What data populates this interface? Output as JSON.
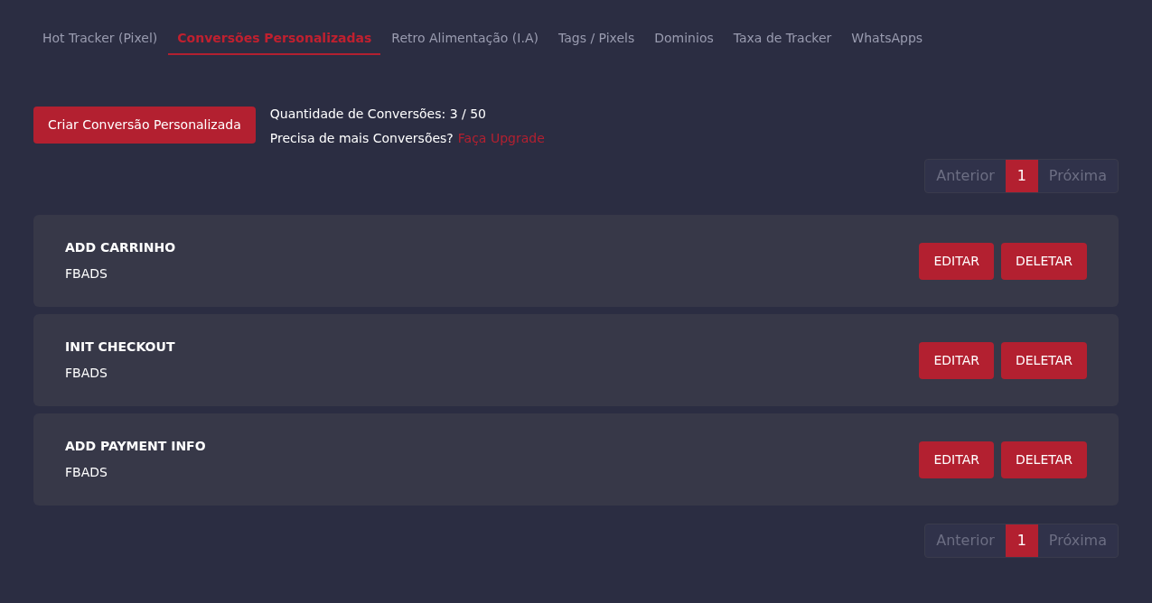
{
  "tabs": [
    {
      "label": "Hot Tracker (Pixel)",
      "selected": false
    },
    {
      "label": "Conversões Personalizadas",
      "selected": true
    },
    {
      "label": "Retro Alimentação (I.A)",
      "selected": false
    },
    {
      "label": "Tags / Pixels",
      "selected": false
    },
    {
      "label": "Dominios",
      "selected": false
    },
    {
      "label": "Taxa de Tracker",
      "selected": false
    },
    {
      "label": "WhatsApps",
      "selected": false
    }
  ],
  "create_button": "Criar Conversão Personalizada",
  "quota_text": "Quantidade de Conversões: 3 / 50",
  "upgrade_prompt": "Precisa de mais Conversões?",
  "upgrade_link": "Faça Upgrade",
  "pagination_top": {
    "previous": "Anterior",
    "pages": [
      {
        "label": "1",
        "selected": true
      }
    ],
    "next": "Próxima"
  },
  "conversions": [
    {
      "name": "ADD CARRINHO",
      "source": "FBADS",
      "edit": "EDITAR",
      "delete": "DELETAR"
    },
    {
      "name": "INIT CHECKOUT",
      "source": "FBADS",
      "edit": "EDITAR",
      "delete": "DELETAR"
    },
    {
      "name": "ADD PAYMENT INFO",
      "source": "FBADS",
      "edit": "EDITAR",
      "delete": "DELETAR"
    }
  ],
  "pagination_bottom": {
    "previous": "Anterior",
    "pages": [
      {
        "label": "1",
        "selected": true
      }
    ],
    "next": "Próxima"
  }
}
